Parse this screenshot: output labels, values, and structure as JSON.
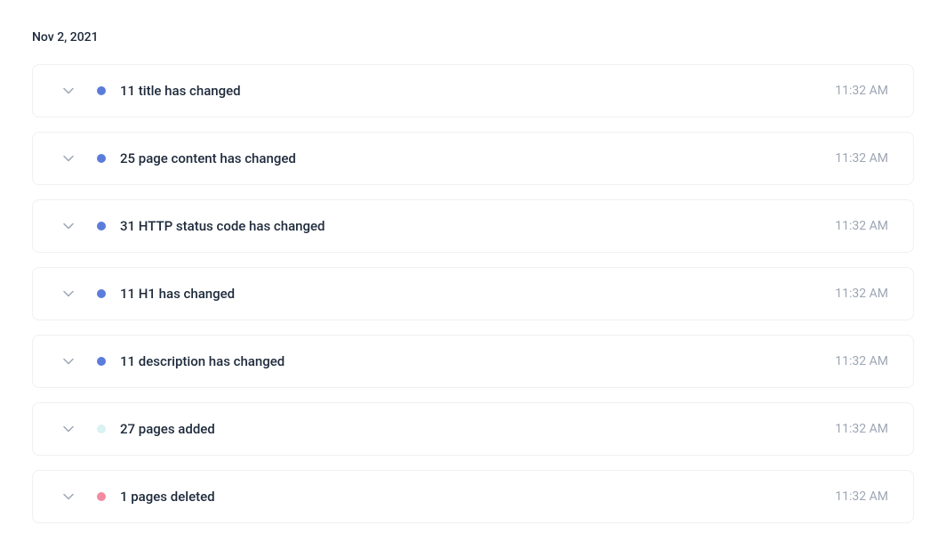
{
  "date": "Nov 2, 2021",
  "events": [
    {
      "label": "11 title has changed",
      "time": "11:32 AM",
      "dotColor": "blue"
    },
    {
      "label": "25 page content has changed",
      "time": "11:32 AM",
      "dotColor": "blue"
    },
    {
      "label": "31 HTTP status code has changed",
      "time": "11:32 AM",
      "dotColor": "blue"
    },
    {
      "label": "11 H1 has changed",
      "time": "11:32 AM",
      "dotColor": "blue"
    },
    {
      "label": "11 description has changed",
      "time": "11:32 AM",
      "dotColor": "blue"
    },
    {
      "label": "27 pages added",
      "time": "11:32 AM",
      "dotColor": "lightblue"
    },
    {
      "label": "1 pages deleted",
      "time": "11:32 AM",
      "dotColor": "pink"
    }
  ]
}
